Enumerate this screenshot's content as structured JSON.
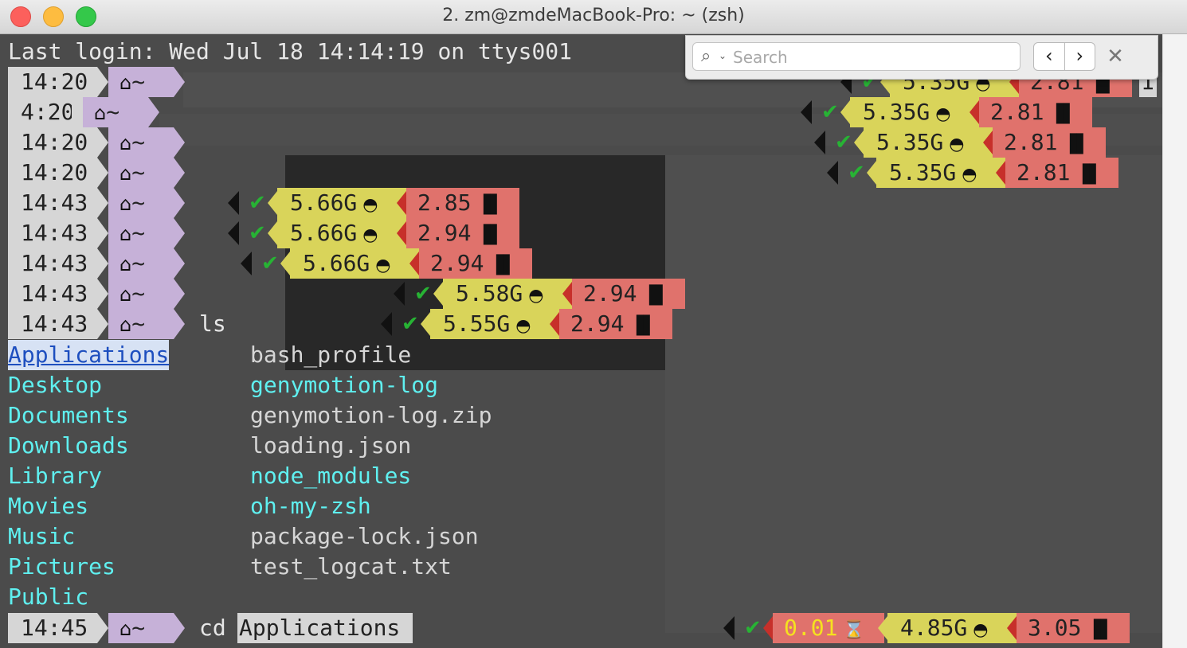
{
  "window": {
    "title": "2. zm@zmdeMacBook-Pro: ~ (zsh)"
  },
  "search": {
    "placeholder": "Search",
    "value": ""
  },
  "terminal": {
    "last_login": "Last login: Wed Jul 18 14:14:19 on ttys001",
    "home_tilde": "~",
    "prompt_rows": [
      {
        "time": "14:20",
        "cmd": "",
        "mem": "5.35G",
        "load": "2.81"
      },
      {
        "time": "4:20",
        "cmd": "",
        "mem": "5.35G",
        "load": "2.81"
      },
      {
        "time": "14:20",
        "cmd": "",
        "mem": "5.35G",
        "load": "2.81"
      },
      {
        "time": "14:20",
        "cmd": "",
        "mem": "5.35G",
        "load": "2.81"
      },
      {
        "time": "14:43",
        "cmd": "",
        "mem": "5.66G",
        "load": "2.85"
      },
      {
        "time": "14:43",
        "cmd": "",
        "mem": "5.66G",
        "load": "2.94"
      },
      {
        "time": "14:43",
        "cmd": "",
        "mem": "5.66G",
        "load": "2.94"
      },
      {
        "time": "14:43",
        "cmd": "",
        "mem": "5.58G",
        "load": "2.94"
      },
      {
        "time": "14:43",
        "cmd": "ls",
        "mem": "5.55G",
        "load": "2.94"
      }
    ],
    "partial_right": "1",
    "ls_left": [
      "Applications",
      "Desktop",
      "Documents",
      "Downloads",
      "Library",
      "Movies",
      "Music",
      "Pictures",
      "Public"
    ],
    "ls_right": [
      "bash_profile",
      "genymotion-log",
      "genymotion-log.zip",
      "loading.json",
      "node_modules",
      "oh-my-zsh",
      "package-lock.json",
      "test_logcat.txt"
    ],
    "last_prompt": {
      "time": "14:45",
      "cmd": "cd ",
      "cmd_arg": "Applications",
      "exec_time": "0.01",
      "mem": "4.85G",
      "load": "3.05"
    }
  },
  "colors": {
    "time_segment": "#d6d6d6",
    "dir_segment": "#c6b1d8",
    "mem_segment": "#d9d45a",
    "load_segment": "#e0726c",
    "ok_check": "#27b334",
    "dir_listing": "#5ff0f0"
  },
  "icons": [
    "home-icon",
    "check-icon",
    "gauge-icon",
    "bar-chart-icon",
    "hourglass-icon",
    "search-icon",
    "chevron-left-icon",
    "chevron-right-icon",
    "close-icon"
  ]
}
